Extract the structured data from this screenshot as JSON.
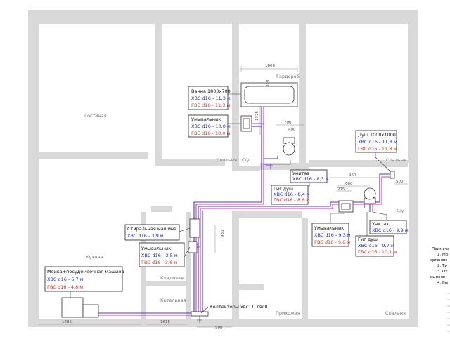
{
  "rooms": {
    "living": "Гостиная",
    "wardrobe": "Гардероб",
    "bedroom_1": "Спальня",
    "wc_1": "С/у",
    "bedroom_2": "Спальня",
    "wc_2": "С/у",
    "kitchen": "Кухная",
    "pantry": "Кладовая",
    "boiler": "Котельная",
    "hall": "Прихожая",
    "bedroom_3": "Спальня"
  },
  "fixtures": {
    "bath": {
      "title": "Ванна 1800x700",
      "cold": "ХВС d16 - 11,3 м",
      "hot": "ГВС d16 - 11,3 м"
    },
    "sink_1": {
      "title": "Умывальник",
      "cold": "ХВС d16 - 10,0 м",
      "hot": "ГВС d16 - 10,0 м"
    },
    "toilet_1": {
      "title": "Унитаз",
      "cold": "ХВС d16 - 8,3 м"
    },
    "hygiene_1": {
      "title": "Гиг душ",
      "cold": "ХВС d16 - 8,4 м",
      "hot": "ГВС d16 - 8,6 м"
    },
    "shower": {
      "title": "Душ 1000x1000",
      "cold": "ХВС d16 - 11,8 м",
      "hot": "ГВС d16 - 11,8 м"
    },
    "sink_2": {
      "title": "Умывальник",
      "cold": "ХВС d16 - 9,3 м",
      "hot": "ГВС d16 - 9,6 м"
    },
    "toilet_2": {
      "title": "Унитаз",
      "cold": "ХВС d16 - 9,9 м"
    },
    "hygiene_2": {
      "title": "Гиг душ",
      "cold": "ХВС d16 - 9,7 м",
      "hot": "ГВС d16 - 10,1 м"
    },
    "washer": {
      "title": "Стиральная машина",
      "cold": "ХВС d16 - 3,9 м"
    },
    "sink_3": {
      "title": "Умывальник",
      "cold": "ХВС d16 - 3,5 м",
      "hot": "ГВС d16 - 3,6 м"
    },
    "kitchen_sink": {
      "title": "Мойка+посудомоечная машина",
      "cold": "ХВС d16 - 5,7 м",
      "hot": "ГВС d16 - 4,8 м"
    }
  },
  "collector": "Коллекторы хвс11, гвс8",
  "dimensions": {
    "d1800": "1800",
    "d350": "350",
    "d1375": "1375",
    "d700": "700",
    "d400": "400",
    "d950": "950",
    "d660": "660",
    "d275": "275",
    "d500": "500",
    "d980": "980",
    "d1485": "1485",
    "d1615": "1615",
    "d900": "900"
  },
  "notes": {
    "heading": "Примеча",
    "lines": [
      "1. Мо",
      "эргоном",
      "2. Тр",
      "3. От",
      "выполн",
      "4. Вы"
    ]
  },
  "colors": {
    "cold": "#1f2fd0",
    "hot": "#e0302a",
    "pipe_cold": "#3b3bd6",
    "pipe_hot": "#d83aa9",
    "wall": "#d9d9d9"
  }
}
